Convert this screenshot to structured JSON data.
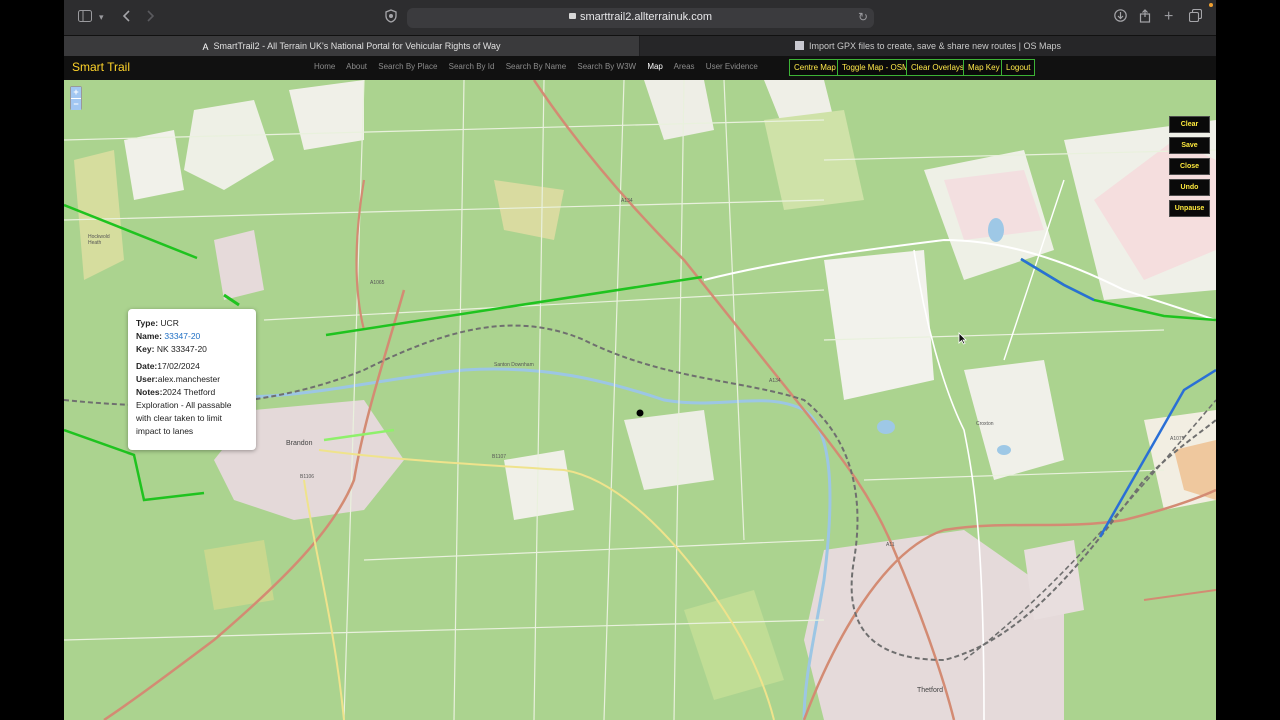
{
  "browser": {
    "url": "smarttrail2.allterrainuk.com",
    "tabs": [
      {
        "title": "SmartTrail2 - All Terrain UK's National Portal for Vehicular Rights of Way",
        "active": true
      },
      {
        "title": "Import GPX files to create, save & share new routes | OS Maps",
        "active": false
      }
    ],
    "icons": [
      "sidebar-icon",
      "chevron-down-icon",
      "back-icon",
      "forward-icon",
      "shield-icon",
      "lock-icon",
      "reload-icon",
      "download-icon",
      "share-icon",
      "new-tab-icon",
      "tab-overview-icon"
    ]
  },
  "site": {
    "brand": "Smart Trail",
    "nav": [
      "Home",
      "About",
      "Search By Place",
      "Search By Id",
      "Search By Name",
      "Search By W3W",
      "Map",
      "Areas",
      "User Evidence"
    ],
    "current": "Map",
    "buttons": [
      "Centre Map",
      "Toggle Map - OSM",
      "Clear Overlays",
      "Map Key",
      "Logout"
    ]
  },
  "map": {
    "zoom_in": "+",
    "zoom_out": "−",
    "side_buttons": [
      "Clear",
      "Save",
      "Close",
      "Undo",
      "Unpause"
    ],
    "labels": {
      "brandon": "Brandon",
      "thetford": "Thetford",
      "a134": "A134",
      "a1065": "A1065",
      "a11": "A11",
      "b1107": "B1107",
      "b1106": "B1106",
      "a1075": "A1075",
      "croxton": "Croxton",
      "hockwold": "Hockwold Heath",
      "santon": "Santon Downham"
    },
    "popup": {
      "type_label": "Type:",
      "type_value": "UCR",
      "name_label": "Name:",
      "name_value": "33347-20",
      "key_label": "Key:",
      "key_value": "NK 33347-20",
      "date_label": "Date:",
      "date_value": "17/02/2024",
      "user_label": "User:",
      "user_value": "alex.manchester",
      "notes_label": "Notes:",
      "notes_value": "2024 Thetford Exploration - All passable with clear taken to limit impact to lanes"
    },
    "colors": {
      "route_green": "#1fc31f",
      "route_blue": "#2a6fd6",
      "road_red": "#d07f68",
      "rail": "#777777"
    }
  }
}
